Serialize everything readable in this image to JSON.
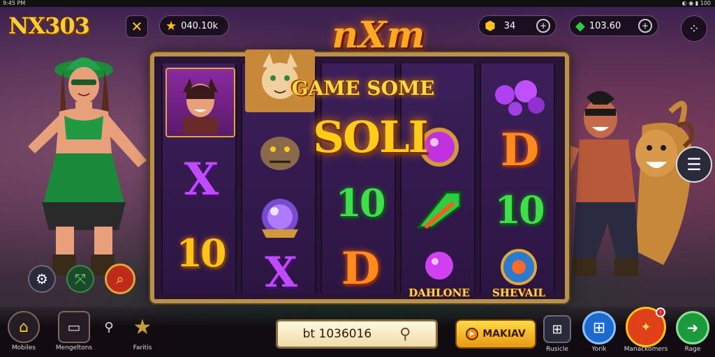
{
  "status_bar": {
    "left": "9:45 PM",
    "right": "◐ ◉ ▮ 100"
  },
  "header": {
    "logo": "NX303",
    "close_icon": "close-icon",
    "balance_1": "040.10k",
    "balance_2": "34",
    "balance_3": "103.60",
    "menu_icon": "menu-dots-icon"
  },
  "game": {
    "title_top": "nXm",
    "title_banner": "GAME SOME",
    "win_text": "SOLI",
    "reels": [
      {
        "symbols": [
          {
            "type": "char",
            "label": ""
          },
          {
            "type": "x",
            "label": "X"
          },
          {
            "type": "num",
            "text": "10",
            "color": "gold"
          }
        ]
      },
      {
        "symbols": [
          {
            "type": "char",
            "label": ""
          },
          {
            "type": "orb",
            "label": ""
          },
          {
            "type": "x",
            "label": "X"
          }
        ]
      },
      {
        "symbols": [
          {
            "type": "blank",
            "label": ""
          },
          {
            "type": "num",
            "text": "10",
            "color": "green"
          },
          {
            "type": "num",
            "text": "D",
            "color": "orange"
          }
        ]
      },
      {
        "symbols": [
          {
            "type": "orb",
            "label": ""
          },
          {
            "type": "arrow",
            "label": ""
          },
          {
            "type": "gem",
            "label": "DAHLONE"
          }
        ]
      },
      {
        "symbols": [
          {
            "type": "gem",
            "label": ""
          },
          {
            "type": "num",
            "text": "D",
            "color": "orange"
          },
          {
            "type": "num",
            "text": "10",
            "color": "green"
          },
          {
            "type": "gem",
            "label": "SHEVAIL"
          }
        ]
      }
    ]
  },
  "bottom": {
    "nav": [
      {
        "label": "Mobiles",
        "icon": "home-icon"
      },
      {
        "label": "Mengeltons",
        "icon": "folder-icon"
      },
      {
        "label": "",
        "icon": "pin-icon"
      },
      {
        "label": "Faritis",
        "icon": "star-icon"
      }
    ],
    "bet_value": "bt 1036016",
    "bet_icon": "search-icon",
    "spin_label": "MAKIAV",
    "right_buttons": [
      {
        "label": "Rusicle",
        "icon": "grid-icon"
      },
      {
        "label": "Yorik",
        "icon": "windows-icon"
      },
      {
        "label": "Manackomers",
        "icon": "bonus-icon"
      },
      {
        "label": "Rage",
        "icon": "arrow-icon"
      }
    ]
  },
  "side_buttons": {
    "left_1": "gear-icon",
    "left_2": "arrows-icon",
    "left_3": "search-icon",
    "right_menu": "hamburger-icon"
  }
}
